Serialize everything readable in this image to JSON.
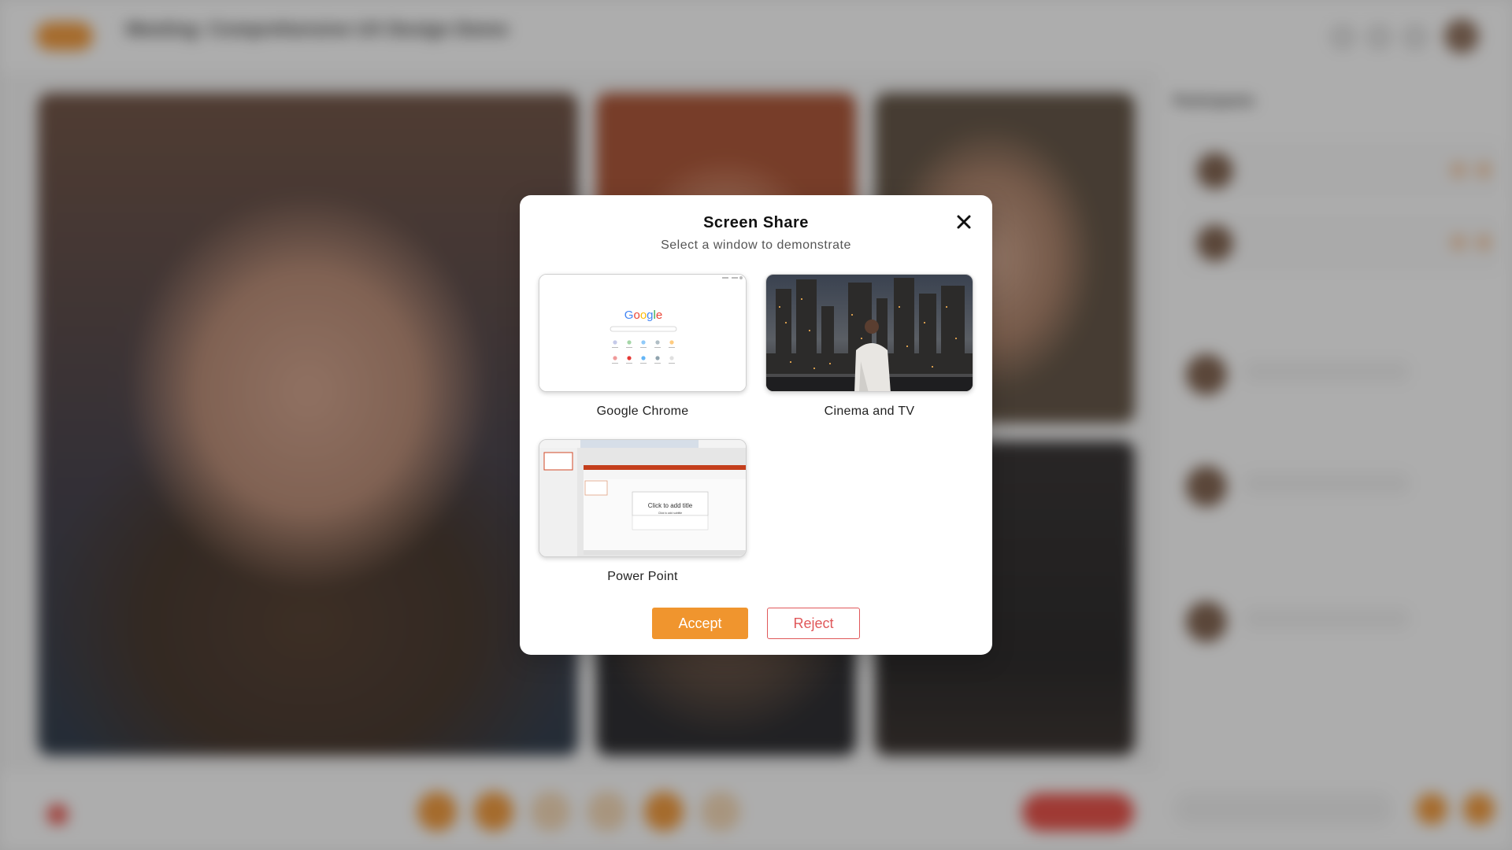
{
  "background_app": {
    "meeting_title": "Meeting: Comprehensive UX Design Demo",
    "meeting_subtitle": "",
    "participants_title": "Participants",
    "participants_link": "",
    "participants": [
      {
        "name": ""
      },
      {
        "name": ""
      }
    ],
    "tabs": [
      {
        "label": ""
      },
      {
        "label": ""
      },
      {
        "label": ""
      }
    ],
    "messages": [
      {
        "text": ""
      },
      {
        "text": ""
      },
      {
        "text": ""
      }
    ],
    "recording_text": ""
  },
  "modal": {
    "title": "Screen Share",
    "subtitle": "Select a window to demonstrate",
    "windows": [
      {
        "label": "Google Chrome",
        "icon": "chrome-window-thumbnail"
      },
      {
        "label": "Cinema and TV",
        "icon": "cinema-window-thumbnail"
      },
      {
        "label": "Power Point",
        "icon": "powerpoint-window-thumbnail"
      }
    ],
    "chrome_thumb": {
      "logo_text": "Google"
    },
    "ppt_thumb": {
      "title_placeholder": "Click to add title",
      "subtitle_placeholder": "Click to add subtitle"
    },
    "accept_label": "Accept",
    "reject_label": "Reject"
  },
  "colors": {
    "accent": "#f0952e",
    "reject": "#e0585a",
    "overlay": "rgba(40,40,40,0.38)"
  }
}
